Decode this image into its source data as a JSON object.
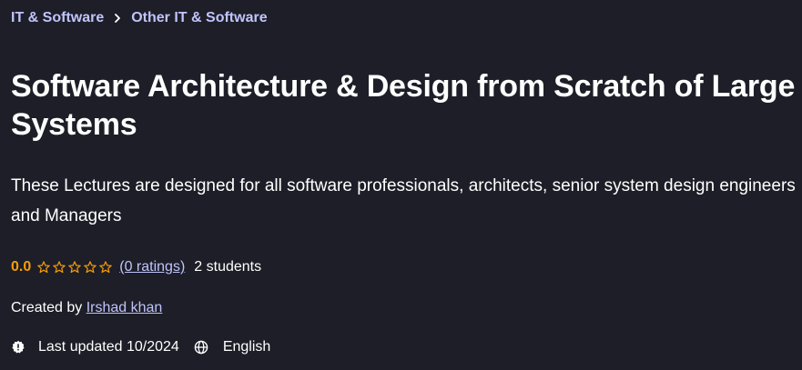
{
  "breadcrumb": {
    "items": [
      "IT & Software",
      "Other IT & Software"
    ]
  },
  "course": {
    "title": "Software Architecture & Design from Scratch of Large Systems",
    "subtitle": "These Lectures are designed for all software professionals, architects, senior system design engineers and Managers"
  },
  "rating": {
    "value": "0.0",
    "stars_filled": 0,
    "stars_total": 5,
    "ratings_count_label": "(0 ratings)",
    "students_label": "2 students"
  },
  "creator": {
    "prefix": "Created by",
    "name": "Irshad khan"
  },
  "meta": {
    "last_updated": "Last updated 10/2024",
    "language": "English",
    "updated_icon": "alert-badge-icon",
    "language_icon": "globe-icon"
  },
  "colors": {
    "background": "#1d1e27",
    "link": "#c0c4fc",
    "rating": "#f69c08",
    "text": "#ffffff"
  }
}
